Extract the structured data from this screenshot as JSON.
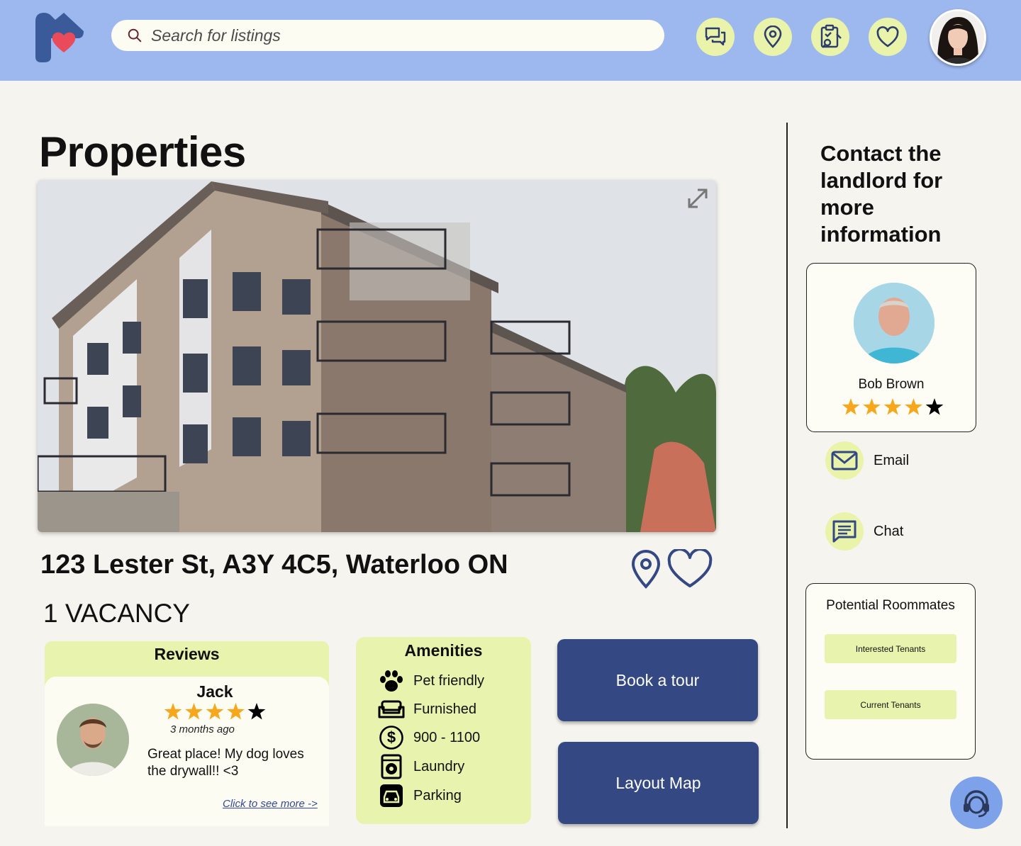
{
  "header": {
    "search_placeholder": "Search for listings",
    "icons": [
      "chat-icon",
      "map-pin-icon",
      "clipboard-search-icon",
      "heart-icon"
    ]
  },
  "main": {
    "title": "Properties",
    "address": "123 Lester St, A3Y 4C5, Waterloo ON",
    "vacancy": "1 VACANCY"
  },
  "reviews": {
    "title": "Reviews",
    "reviewer": "Jack",
    "rating": 4,
    "time": "3 months ago",
    "text": "Great place! My dog loves the drywall!! <3",
    "see_more": "Click to see more ->"
  },
  "amenities": {
    "title": "Amenities",
    "items": [
      {
        "icon": "paw-icon",
        "label": "Pet friendly"
      },
      {
        "icon": "sofa-icon",
        "label": "Furnished"
      },
      {
        "icon": "dollar-icon",
        "label": "900 - 1100"
      },
      {
        "icon": "washer-icon",
        "label": "Laundry"
      },
      {
        "icon": "car-icon",
        "label": "Parking"
      }
    ]
  },
  "actions": {
    "book_tour": "Book a tour",
    "layout_map": "Layout Map"
  },
  "sidebar": {
    "contact_title": "Contact the landlord for more information",
    "landlord_name": "Bob Brown",
    "landlord_rating": 4,
    "email_label": "Email",
    "chat_label": "Chat",
    "roommates_title": "Potential Roommates",
    "interested_label": "Interested Tenants",
    "current_label": "Current Tenants"
  },
  "colors": {
    "header_bg": "#9db8ee",
    "accent_green": "#e8f3ad",
    "primary_blue": "#344983",
    "star": "#f7a71b"
  }
}
